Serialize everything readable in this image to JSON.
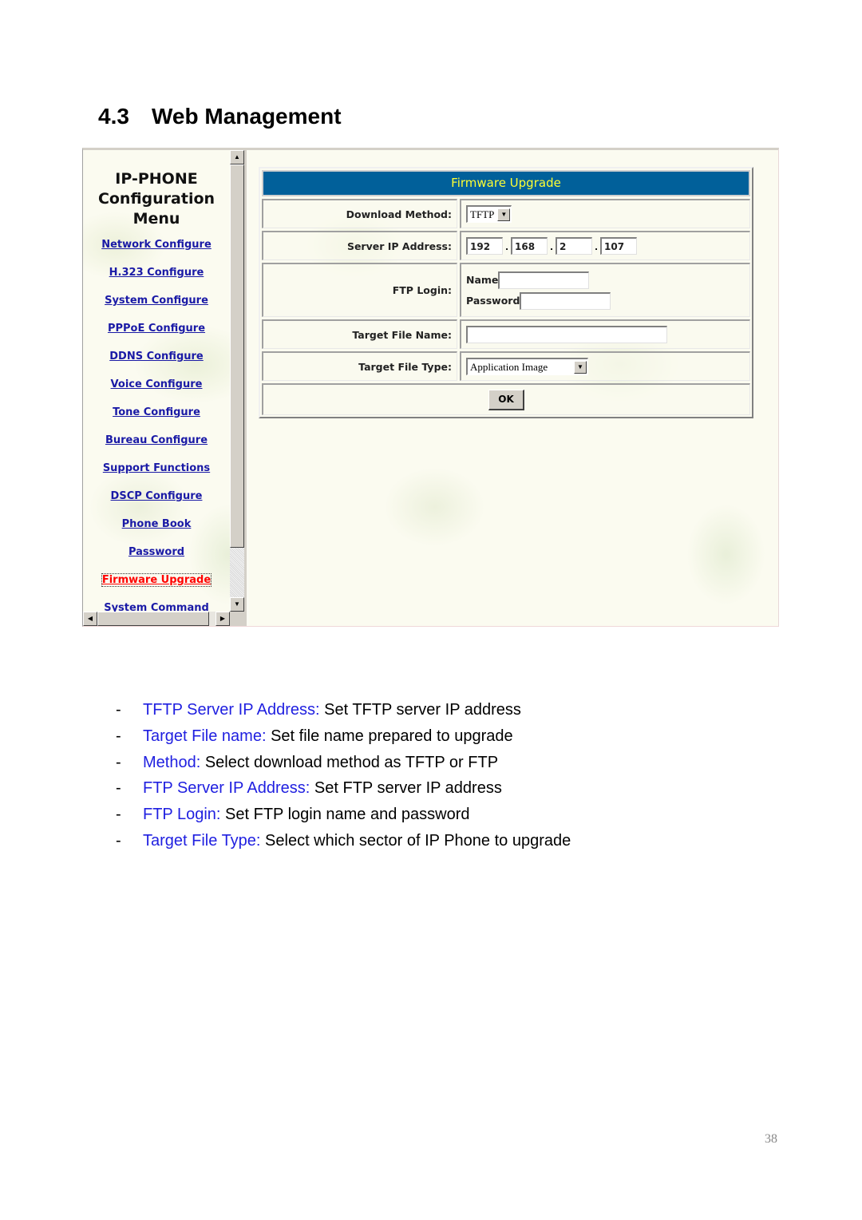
{
  "section": {
    "number": "4.3",
    "title": "Web Management"
  },
  "screenshot": {
    "menu": {
      "heading_lines": [
        "IP-PHONE",
        "Configuration",
        "Menu"
      ],
      "items": [
        {
          "label": "Network Configure",
          "active": false
        },
        {
          "label": "H.323 Configure",
          "active": false
        },
        {
          "label": "System Configure",
          "active": false
        },
        {
          "label": "PPPoE Configure",
          "active": false
        },
        {
          "label": "DDNS Configure",
          "active": false
        },
        {
          "label": "Voice Configure",
          "active": false
        },
        {
          "label": "Tone Configure",
          "active": false
        },
        {
          "label": "Bureau Configure",
          "active": false
        },
        {
          "label": "Support Functions",
          "active": false
        },
        {
          "label": "DSCP Configure",
          "active": false
        },
        {
          "label": "Phone Book",
          "active": false
        },
        {
          "label": "Password",
          "active": false
        },
        {
          "label": "Firmware Upgrade",
          "active": true
        },
        {
          "label": "System Command",
          "active": false
        }
      ],
      "scroll_icons": {
        "up": "arrow-up-icon",
        "down": "arrow-down-icon",
        "left": "arrow-left-icon",
        "right": "arrow-right-icon"
      }
    },
    "form": {
      "title": "Firmware Upgrade",
      "download_method": {
        "label": "Download Method:",
        "value": "TFTP"
      },
      "server_ip": {
        "label": "Server IP Address:",
        "octets": [
          "192",
          "168",
          "2",
          "107"
        ],
        "separator": "."
      },
      "ftp_login": {
        "label": "FTP Login:",
        "name_label": "Name",
        "name_value": "",
        "password_label": "Password",
        "password_value": ""
      },
      "target_file_name": {
        "label": "Target File Name:",
        "value": ""
      },
      "target_file_type": {
        "label": "Target File Type:",
        "value": "Application Image"
      },
      "ok_label": "OK"
    },
    "colors": {
      "header_bg": "#01609a",
      "header_text": "#ffff33",
      "link": "#1a1aa6",
      "active_link": "#ff0000"
    }
  },
  "bullets": [
    {
      "dash": "-",
      "term": "TFTP Server IP Address:",
      "desc": " Set TFTP server IP address"
    },
    {
      "dash": "-",
      "term": "Target File name:",
      "desc": " Set file name prepared to upgrade"
    },
    {
      "dash": "-",
      "term": "Method:",
      "desc": " Select download method as TFTP or FTP"
    },
    {
      "dash": "-",
      "term": "FTP Server IP Address:",
      "desc": " Set FTP server IP address"
    },
    {
      "dash": "-",
      "term": "FTP Login:",
      "desc": " Set FTP login name and password"
    },
    {
      "dash": "-",
      "term": "Target File Type:",
      "desc": " Select which sector of IP Phone to upgrade"
    }
  ],
  "page_number": "38"
}
